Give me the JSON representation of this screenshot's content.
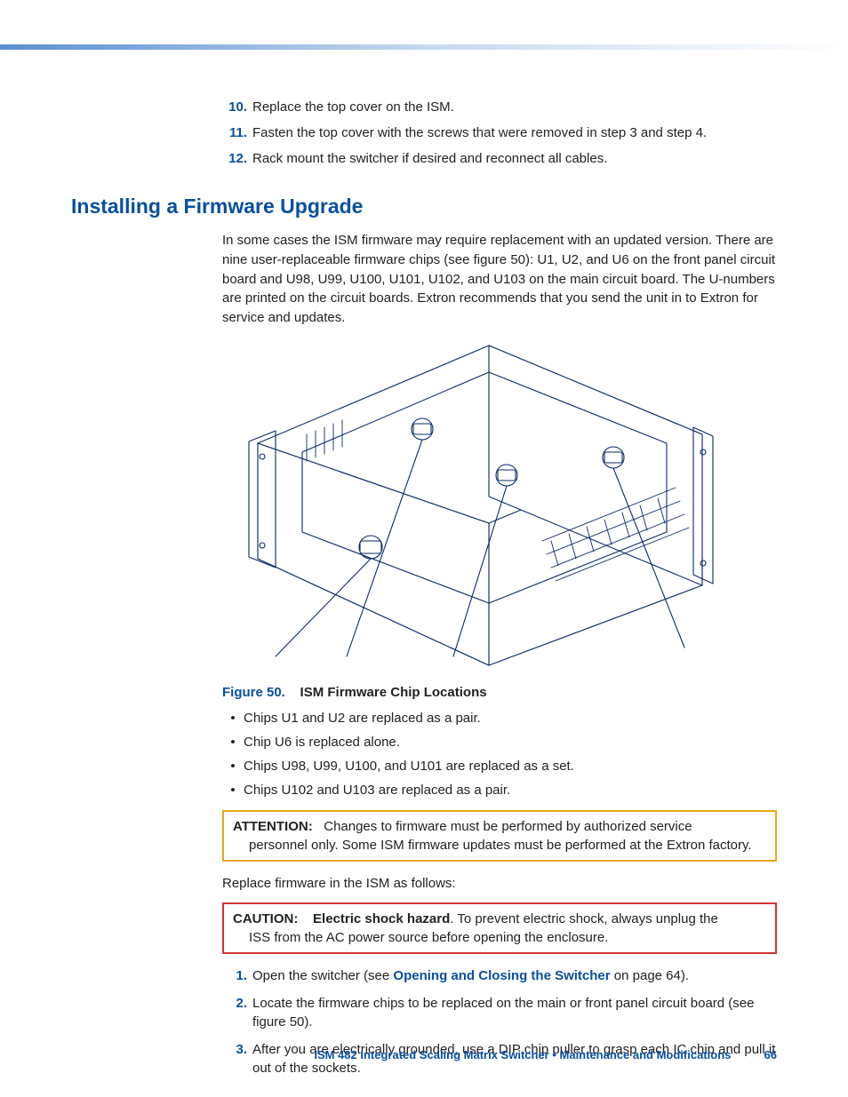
{
  "steps_top": [
    {
      "n": "10.",
      "t": "Replace the top cover on the ISM."
    },
    {
      "n": "11.",
      "t": "Fasten the top cover with the screws that were removed in step 3 and step 4."
    },
    {
      "n": "12.",
      "t": "Rack mount the switcher if desired and reconnect all cables."
    }
  ],
  "section_title": "Installing a Firmware Upgrade",
  "intro": "In some cases the ISM firmware may require replacement with an updated version. There are nine user-replaceable firmware chips (see figure 50): U1, U2, and U6 on the front panel circuit board and U98, U99, U100, U101, U102, and U103 on the main circuit board. The U-numbers are printed on the circuit boards. Extron recommends that you send the unit in to Extron for service and updates.",
  "figure": {
    "label": "Figure 50.",
    "caption": "ISM Firmware Chip Locations"
  },
  "bullets": [
    "Chips U1 and U2 are replaced as a pair.",
    "Chip U6 is replaced alone.",
    "Chips U98, U99, U100, and U101 are replaced as a set.",
    "Chips U102 and U103 are replaced as a pair."
  ],
  "attention": {
    "label": "ATTENTION:",
    "text": "Changes to firmware must be performed by authorized service personnel only. Some ISM firmware updates must be performed at the Extron factory."
  },
  "replace_lead": "Replace firmware in the ISM as follows:",
  "caution": {
    "label": "CAUTION:",
    "bold": "Electric shock hazard",
    "text": ". To prevent electric shock, always unplug the ISS from the AC power source before opening the enclosure."
  },
  "steps_bottom": [
    {
      "n": "1.",
      "pre": "Open the switcher (see ",
      "link": "Opening and Closing the Switcher",
      "post": " on page 64)."
    },
    {
      "n": "2.",
      "t": "Locate the firmware chips to be replaced on the main or front panel circuit board (see figure 50)."
    },
    {
      "n": "3.",
      "t": "After you are electrically grounded, use a DIP chip puller to grasp each IC chip and pull it out of the sockets."
    }
  ],
  "footer": {
    "title": "ISM 482 Integrated Scaling Matrix Switcher • Maintenance and Modifications",
    "page": "66"
  }
}
